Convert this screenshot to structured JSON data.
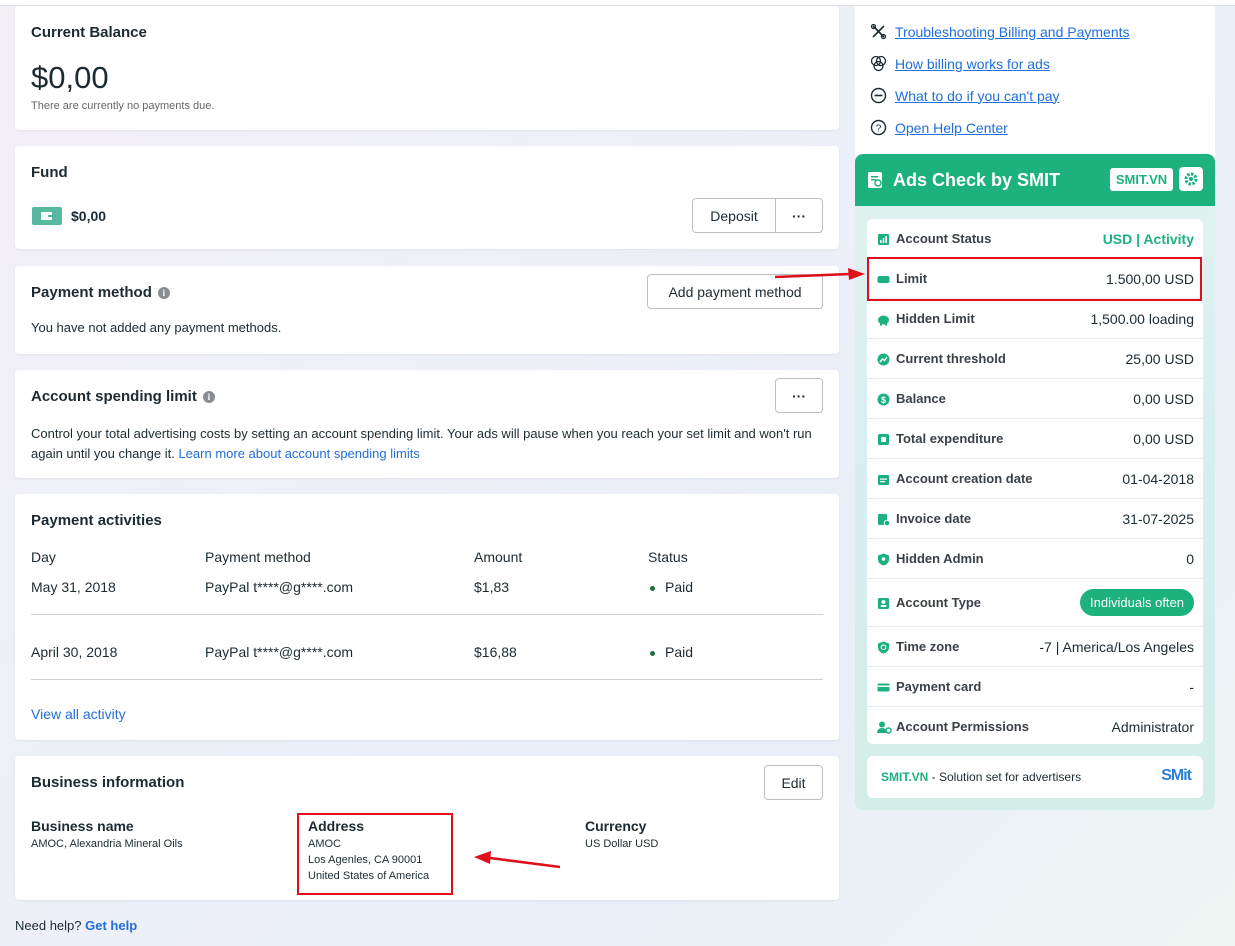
{
  "balance": {
    "title": "Current Balance",
    "amount": "$0,00",
    "note": "There are currently no payments due."
  },
  "fund": {
    "title": "Fund",
    "amount": "$0,00",
    "deposit_label": "Deposit",
    "more_label": "···"
  },
  "payment_method": {
    "title": "Payment method",
    "add_label": "Add payment method",
    "empty_text": "You have not added any payment methods."
  },
  "spending_limit": {
    "title": "Account spending limit",
    "more_label": "···",
    "description": "Control your total advertising costs by setting an account spending limit. Your ads will pause when you reach your set limit and won't run again until you change it.",
    "link": "Learn more about account spending limits"
  },
  "activities": {
    "title": "Payment activities",
    "headers": [
      "Day",
      "Payment method",
      "Amount",
      "Status"
    ],
    "rows": [
      {
        "day": "May 31, 2018",
        "method": "PayPal t****@g****.com",
        "amount": "$1,83",
        "status": "Paid"
      },
      {
        "day": "April 30, 2018",
        "method": "PayPal t****@g****.com",
        "amount": "$16,88",
        "status": "Paid"
      }
    ],
    "view_all": "View all activity"
  },
  "business": {
    "title": "Business information",
    "edit_label": "Edit",
    "name_label": "Business name",
    "name_value": "AMOC, Alexandria Mineral Oils",
    "address_label": "Address",
    "address_lines": [
      "AMOC",
      "Los Agenles, CA 90001",
      "United States of America"
    ],
    "currency_label": "Currency",
    "currency_value": "US Dollar USD"
  },
  "help": {
    "prefix": "Need help?",
    "link": "Get help"
  },
  "help_links": [
    {
      "label": "Troubleshooting Billing and Payments",
      "icon": "tools-icon"
    },
    {
      "label": "How billing works for ads",
      "icon": "billing-icon"
    },
    {
      "label": "What to do if you can't pay",
      "icon": "minus-circle-icon"
    },
    {
      "label": "Open Help Center",
      "icon": "question-icon"
    }
  ],
  "smit": {
    "title": "Ads Check by SMIT",
    "badge": "SMIT.VN",
    "rows": [
      {
        "label": "Account Status",
        "value": "USD | Activity",
        "icon": "chart-icon"
      },
      {
        "label": "Limit",
        "value": "1.500,00 USD",
        "icon": "card-icon"
      },
      {
        "label": "Hidden Limit",
        "value": "1,500.00 loading",
        "icon": "piggy-icon"
      },
      {
        "label": "Current threshold",
        "value": "25,00 USD",
        "icon": "trend-icon"
      },
      {
        "label": "Balance",
        "value": "0,00 USD",
        "icon": "dollar-icon"
      },
      {
        "label": "Total expenditure",
        "value": "0,00 USD",
        "icon": "wallet-icon"
      },
      {
        "label": "Account creation date",
        "value": "01-04-2018",
        "icon": "calendar-icon"
      },
      {
        "label": "Invoice date",
        "value": "31-07-2025",
        "icon": "invoice-icon"
      },
      {
        "label": "Hidden Admin",
        "value": "0",
        "icon": "admin-shield-icon"
      },
      {
        "label": "Account Type",
        "value": "Individuals often",
        "icon": "id-card-icon"
      },
      {
        "label": "Time zone",
        "value": "-7 | America/Los Angeles",
        "icon": "shield-clock-icon"
      },
      {
        "label": "Payment card",
        "value": "-",
        "icon": "payment-card-icon"
      },
      {
        "label": "Account Permissions",
        "value": "Administrator",
        "icon": "user-gear-icon"
      }
    ],
    "footer_brand": "SMIT.VN",
    "footer_text": " - Solution set for advertisers",
    "footer_logo": "SMit"
  },
  "colors": {
    "accent_green": "#1db17e",
    "link_blue": "#216fdb",
    "annotation_red": "#e00f1c"
  }
}
